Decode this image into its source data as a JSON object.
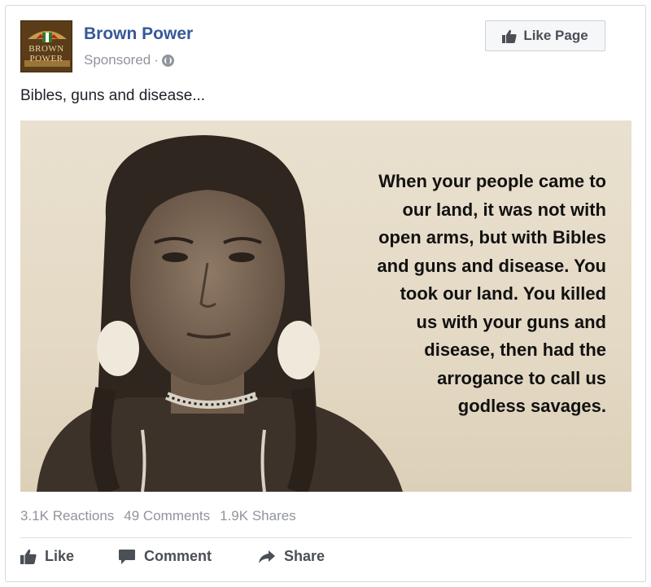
{
  "post": {
    "page_name": "Brown Power",
    "sponsored_label": "Sponsored",
    "separator": "·",
    "avatar_text_top": "BROWN",
    "avatar_text_bottom": "POWER",
    "like_page_label": "Like Page",
    "text": "Bibles, guns and disease...",
    "image_quote": [
      "When your people came to",
      "our land, it was not with",
      "open arms, but with Bibles",
      "and guns and disease. You",
      "took our land. You killed",
      "us with your guns and",
      "disease, then had the",
      "arrogance to call us",
      "godless savages."
    ]
  },
  "stats": {
    "reactions": "3.1K Reactions",
    "comments": "49 Comments",
    "shares": "1.9K Shares"
  },
  "actions": {
    "like": "Like",
    "comment": "Comment",
    "share": "Share"
  },
  "colors": {
    "link_blue": "#365899",
    "meta_gray": "#90949c",
    "action_gray": "#4b4f56"
  }
}
